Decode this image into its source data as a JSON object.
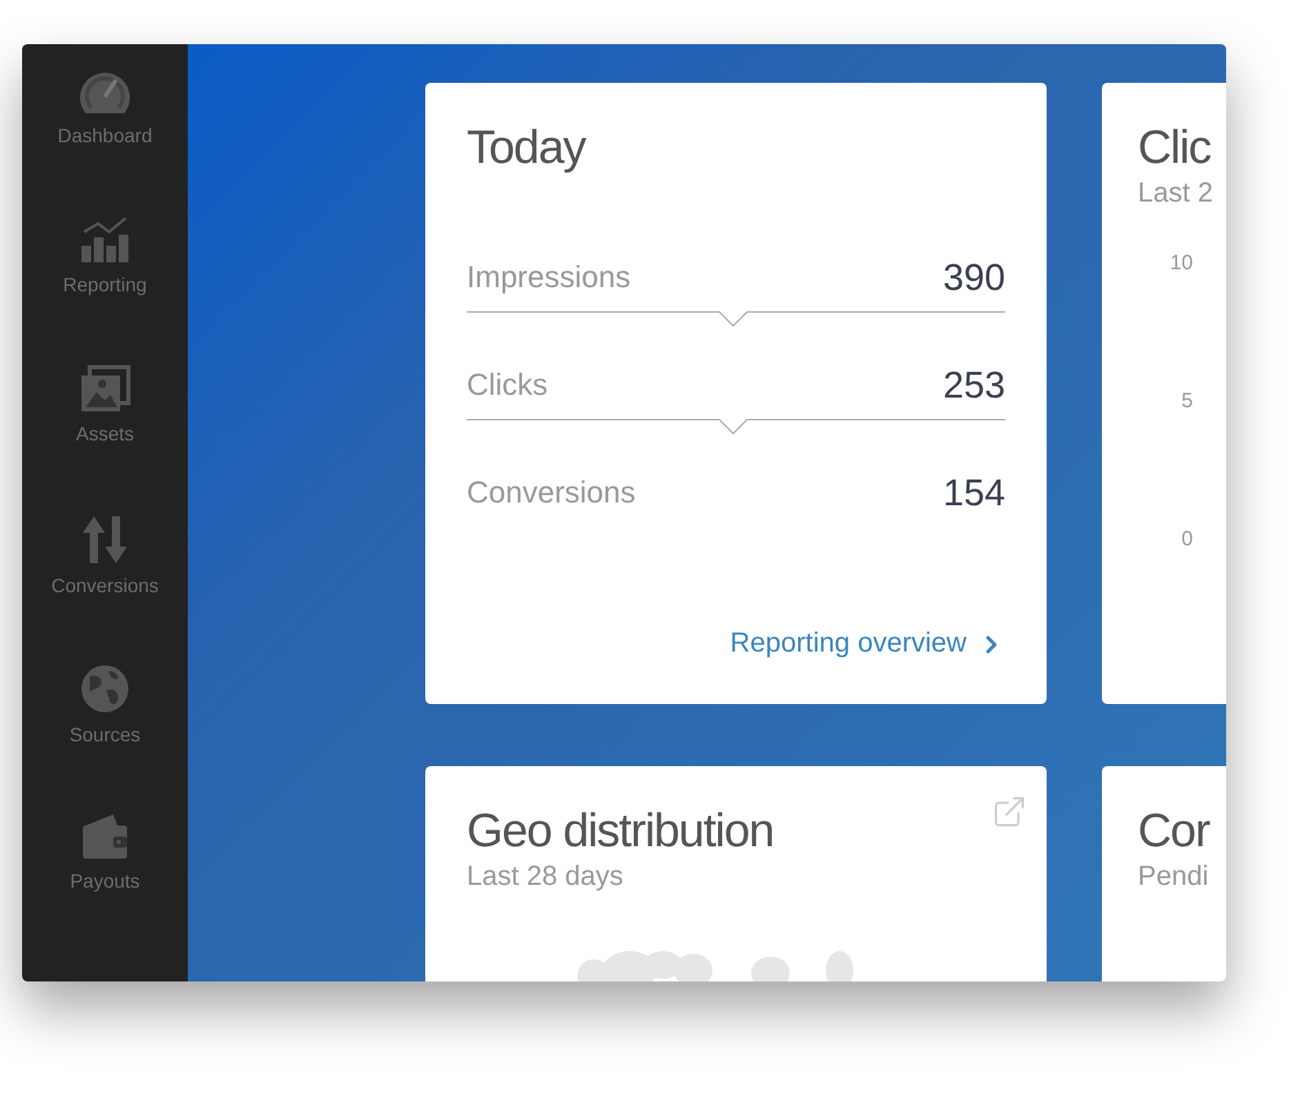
{
  "sidebar": {
    "items": [
      {
        "label": "Dashboard",
        "kind": "gauge"
      },
      {
        "label": "Reporting",
        "kind": "chart"
      },
      {
        "label": "Assets",
        "kind": "images"
      },
      {
        "label": "Conversions",
        "kind": "arrows"
      },
      {
        "label": "Sources",
        "kind": "globe"
      },
      {
        "label": "Payouts",
        "kind": "wallet"
      }
    ]
  },
  "today": {
    "title": "Today",
    "metrics": [
      {
        "label": "Impressions",
        "value": "390"
      },
      {
        "label": "Clicks",
        "value": "253"
      },
      {
        "label": "Conversions",
        "value": "154"
      }
    ],
    "link": "Reporting overview"
  },
  "clicks": {
    "title": "Clic",
    "subtitle": "Last 2",
    "y_axis_labels": [
      "10",
      "5",
      "0"
    ]
  },
  "geo": {
    "title": "Geo distribution",
    "subtitle": "Last 28 days"
  },
  "conversions": {
    "title": "Cor",
    "subtitle": "Pendi"
  }
}
